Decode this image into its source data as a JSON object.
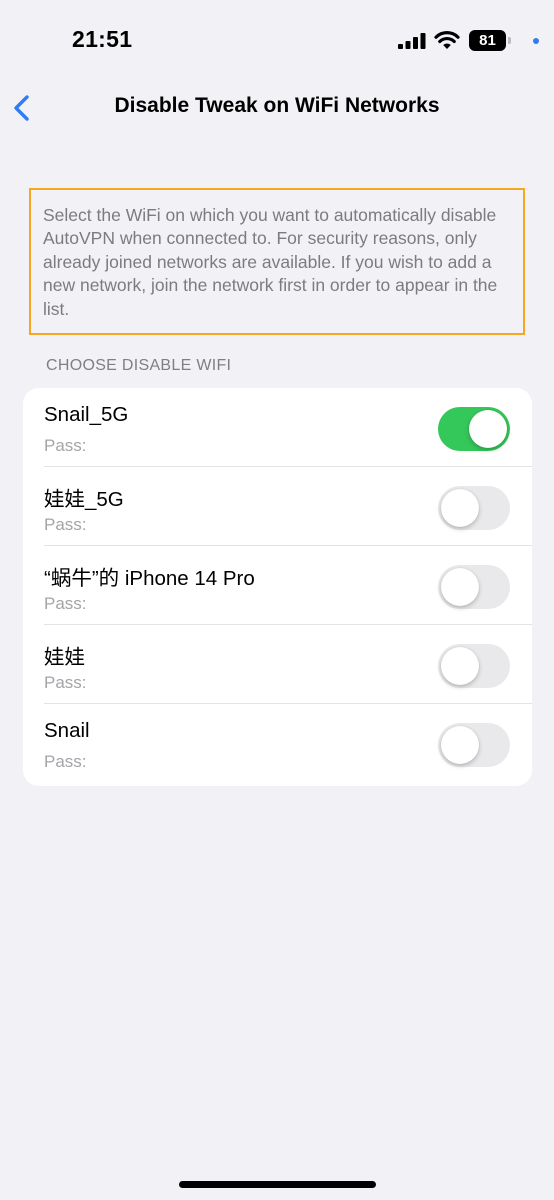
{
  "status_bar": {
    "time": "21:51",
    "battery": "81"
  },
  "nav": {
    "title": "Disable Tweak on WiFi Networks",
    "back_icon": "chevron-left-icon"
  },
  "description": "Select the WiFi on which you want to automatically disable AutoVPN when connected to. For security reasons, only already joined networks are available. If you wish to add a new network, join the network first in order to appear in the list.",
  "section_header": "CHOOSE DISABLE WIFI",
  "networks": [
    {
      "name": "Snail_5G",
      "pass_label": "Pass:",
      "enabled": true
    },
    {
      "name": "娃娃_5G",
      "pass_label": "Pass:",
      "enabled": false
    },
    {
      "name": "“蜗牛”的 iPhone 14 Pro",
      "pass_label": "Pass:",
      "enabled": false
    },
    {
      "name": "娃娃",
      "pass_label": "Pass:",
      "enabled": false
    },
    {
      "name": "Snail",
      "pass_label": "Pass:",
      "enabled": false
    }
  ],
  "colors": {
    "accent": "#2f7cf6",
    "toggle_on": "#34c759",
    "toggle_off": "#e9e9eb",
    "highlight_border": "#f5a623"
  }
}
